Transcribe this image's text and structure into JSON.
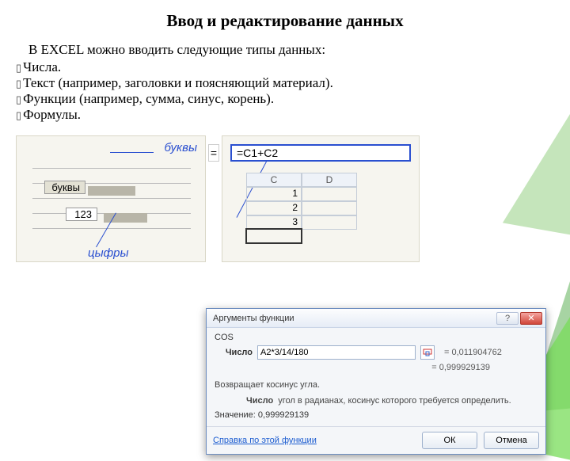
{
  "title": "Ввод и редактирование данных",
  "intro": "В EXCEL можно вводить следующие типы данных:",
  "bullets": [
    "Числа.",
    "Текст (например, заголовки и поясняющий материал).",
    "Функции (например, сумма, синус, корень).",
    "Формулы."
  ],
  "fig1": {
    "label_letters": "буквы",
    "label_digits": "цыфры",
    "cell_text": "буквы",
    "cell_num": "123"
  },
  "fig2": {
    "eq_sign": "=",
    "formula": "=C1+C2",
    "col_c": "C",
    "col_d": "D",
    "rows": [
      "1",
      "2",
      "3"
    ]
  },
  "dialog": {
    "title": "Аргументы функции",
    "help_icon": "?",
    "close_icon": "✕",
    "func_name": "COS",
    "arg_label": "Число",
    "arg_value": "A2*3/14/180",
    "arg_eval": "=  0,011904762",
    "result_preview": "=  0,999929139",
    "desc1": "Возвращает косинус угла.",
    "desc2_label": "Число",
    "desc2_text": "угол в радианах, косинус которого требуется определить.",
    "value_label": "Значение:",
    "value": "0,999929139",
    "help_link": "Справка по этой функции",
    "ok": "ОК",
    "cancel": "Отмена"
  }
}
